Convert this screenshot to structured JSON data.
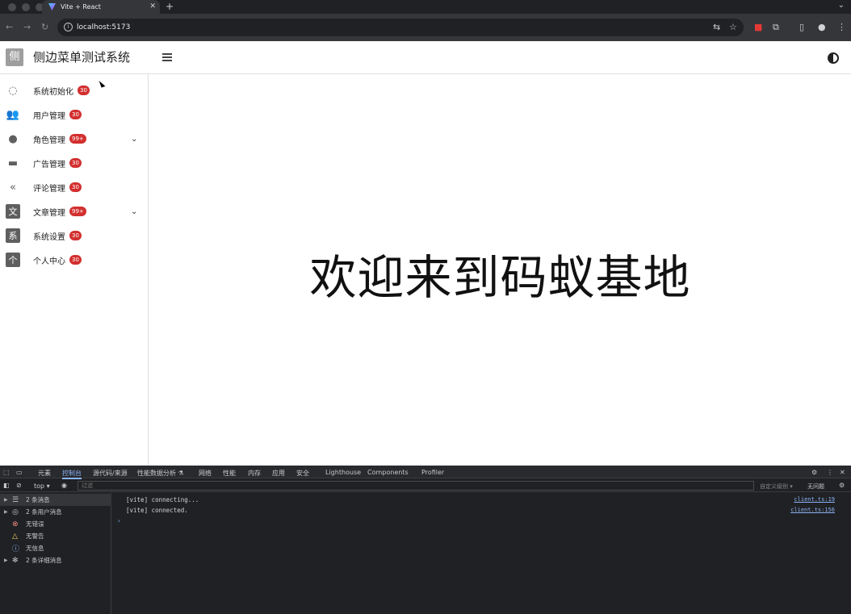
{
  "browser": {
    "tab_title": "Vite + React",
    "url": "localhost:5173"
  },
  "header": {
    "logo_char": "侧",
    "title": "侧边菜单测试系统"
  },
  "sidebar": {
    "items": [
      {
        "label": "系统初始化",
        "badge": "30",
        "icon": "refresh-icon",
        "box": "",
        "expand": false
      },
      {
        "label": "用户管理",
        "badge": "30",
        "icon": "user-add-icon",
        "box": "",
        "expand": false
      },
      {
        "label": "角色管理",
        "badge": "99+",
        "icon": "person-icon",
        "box": "",
        "expand": true
      },
      {
        "label": "广告管理",
        "badge": "30",
        "icon": "ad-icon",
        "box": "",
        "expand": false
      },
      {
        "label": "评论管理",
        "badge": "30",
        "icon": "reply-all-icon",
        "box": "",
        "expand": false
      },
      {
        "label": "文章管理",
        "badge": "99+",
        "icon": "text-box-icon",
        "box": "文",
        "expand": true
      },
      {
        "label": "系统设置",
        "badge": "30",
        "icon": "text-box-icon",
        "box": "系",
        "expand": false
      },
      {
        "label": "个人中心",
        "badge": "30",
        "icon": "text-box-icon",
        "box": "个",
        "expand": false
      }
    ]
  },
  "main": {
    "welcome": "欢迎来到码蚁基地"
  },
  "devtools": {
    "tabs": [
      "元素",
      "控制台",
      "源代码/来源",
      "性能数据分析 ⚗",
      "网络",
      "性能",
      "内存",
      "应用",
      "安全",
      "Lighthouse",
      "Components",
      "Profiler"
    ],
    "context": "top",
    "filter_placeholder": "过滤",
    "levels": "自定义级别 ▾",
    "issues": "无问题",
    "side": [
      {
        "arrow": "▶",
        "icon": "list-icon",
        "text": "2 条消息"
      },
      {
        "arrow": "▶",
        "icon": "user-circle-icon",
        "text": "2 条用户消息"
      },
      {
        "arrow": "",
        "icon": "error-icon",
        "text": "无错误"
      },
      {
        "arrow": "",
        "icon": "warning-icon",
        "text": "无警告"
      },
      {
        "arrow": "",
        "icon": "info-icon",
        "text": "无信息"
      },
      {
        "arrow": "▶",
        "icon": "bug-icon",
        "text": "2 条详细消息"
      }
    ],
    "logs": [
      {
        "text": "[vite] connecting...",
        "src": "client.ts:19"
      },
      {
        "text": "[vite] connected.",
        "src": "client.ts:156"
      }
    ],
    "prompt": "›"
  }
}
